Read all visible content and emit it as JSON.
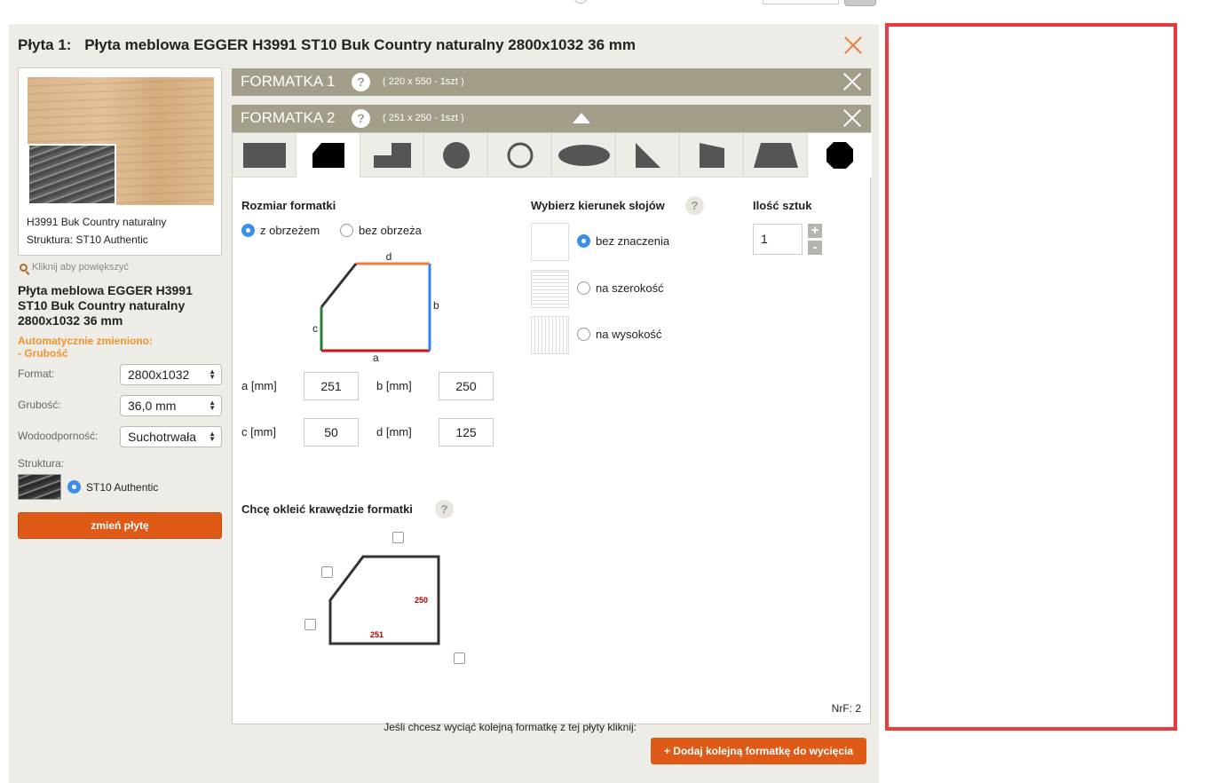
{
  "panel": {
    "number_label": "Płyta 1:",
    "title": "Płyta meblowa EGGER H3991 ST10 Buk Country naturalny 2800x1032 36 mm"
  },
  "left": {
    "thumb_line1": "H3991 Buk Country naturalny",
    "thumb_line2": "Struktura: ST10 Authentic",
    "zoom_link": "Kliknij aby powiększyć",
    "product_name": "Płyta meblowa EGGER H3991 ST10 Buk Country naturalny 2800x1032 36 mm",
    "auto_changed_line1": "Automatycznie zmieniono:",
    "auto_changed_line2": "- Grubość",
    "fields": [
      {
        "label": "Format:",
        "value": "2800x1032"
      },
      {
        "label": "Grubość:",
        "value": "36,0 mm"
      },
      {
        "label": "Wodoodporność:",
        "value": "Suchotrwała"
      }
    ],
    "structure_label": "Struktura:",
    "structure_option": "ST10 Authentic",
    "change_button": "zmień płytę"
  },
  "formatki": [
    {
      "title": "FORMATKA 1",
      "help": "?",
      "dims": "( 220 x 550 - 1szt )"
    },
    {
      "title": "FORMATKA 2",
      "help": "?",
      "dims": "( 251 x 250 - 1szt )"
    }
  ],
  "shapes": [
    "rectangle",
    "cut-corner",
    "step",
    "circle",
    "ring",
    "ellipse",
    "triangle",
    "trapezoid-right",
    "trapezoid",
    "octagon"
  ],
  "size": {
    "title": "Rozmiar formatki",
    "opt_with_edge": "z obrzeżem",
    "opt_without_edge": "bez obrzeża",
    "diagram_labels": {
      "a": "a",
      "b": "b",
      "c": "c",
      "d": "d"
    },
    "edge_colors": {
      "a": "#d0101a",
      "b": "#2f86e8",
      "c": "#2e7d32",
      "d": "#f07a3c"
    },
    "inputs": [
      {
        "label": "a [mm]",
        "value": "251"
      },
      {
        "label": "b [mm]",
        "value": "250"
      },
      {
        "label": "c [mm]",
        "value": "50"
      },
      {
        "label": "d [mm]",
        "value": "125"
      }
    ]
  },
  "grain": {
    "title": "Wybierz kierunek słojów",
    "help": "?",
    "options": [
      "bez znaczenia",
      "na szerokość",
      "na wysokość"
    ],
    "selected": "bez znaczenia"
  },
  "quantity": {
    "title": "Ilość sztuk",
    "value": "1",
    "plus": "+",
    "minus": "-"
  },
  "edging": {
    "title": "Chcę okleić krawędzie formatki",
    "help": "?",
    "label_height": "250",
    "label_width": "251"
  },
  "nrf": "NrF: 2",
  "footer": {
    "text": "Jeśli chcesz wyciąć kolejną formatkę z tej płyty kliknij:",
    "add_button": "+ Dodaj kolejną formatkę do wycięcia"
  }
}
